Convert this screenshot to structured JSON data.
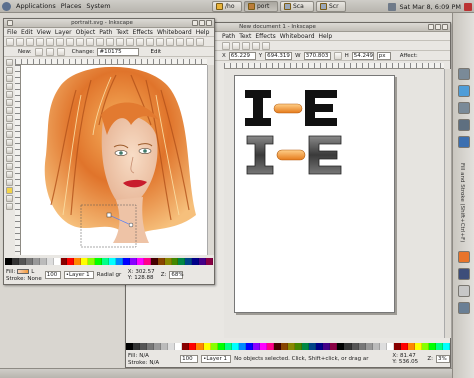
{
  "top_panel": {
    "menus": [
      "Applications",
      "Places",
      "System"
    ],
    "tasks": [
      {
        "label": "/ho"
      },
      {
        "label": "port"
      },
      {
        "label": "Sca"
      },
      {
        "label": "Scr"
      }
    ],
    "clock": "Sat Mar  8,  6:09 PM"
  },
  "left_window": {
    "title": "portrait.svg - Inkscape",
    "menus": [
      "File",
      "Edit",
      "View",
      "Layer",
      "Object",
      "Path",
      "Text",
      "Effects",
      "Whiteboard",
      "Help"
    ],
    "toolbar": {
      "new_label": "New:",
      "change_label": "Change:",
      "change_value": "#10175",
      "edit_label": "Edit"
    },
    "status": {
      "fill_label": "Fill:",
      "fill_value": "L",
      "stroke_label": "Stroke:",
      "stroke_value": "None",
      "opacity": "100",
      "layer": "•Layer 1",
      "gradient_label": "Radial gr",
      "x_label": "X:",
      "x_value": "302.57",
      "y_label": "Y:",
      "y_value": "128.88",
      "z_label": "Z:",
      "z_value": "68%"
    }
  },
  "right_window": {
    "title": "New document 1 - Inkscape",
    "menus": [
      "Path",
      "Text",
      "Effects",
      "Whiteboard",
      "Help"
    ],
    "toolbar": {
      "x_label": "X",
      "x_value": "65.229",
      "y_label": "Y",
      "y_value": "694.319",
      "w_label": "W",
      "w_value": "370.803",
      "h_label": "H",
      "h_value": "54.249",
      "unit": "px",
      "affect_label": "Affect:"
    },
    "status": {
      "fill_label": "Fill:",
      "fill_value": "N/A",
      "stroke_label": "Stroke:",
      "stroke_value": "N/A",
      "opacity": "100",
      "layer": "•Layer 1",
      "message": "No objects selected. Click, Shift+click, or drag ar",
      "x_label": "X:",
      "x_value": "81.47",
      "y_label": "Y:",
      "y_value": "536.05",
      "z_label": "Z:",
      "z_value": "3%"
    },
    "artwork": {
      "row1_letters": "I-E",
      "row2_letters": "I-E"
    }
  },
  "dock": {
    "panel_title": "Fill and Stroke (Shift+Ctrl+F)"
  },
  "colors": {
    "accent_orange": "#f39a3a",
    "panel_gray": "#c2bfb8",
    "hair_orange": "#d9732c",
    "letter_black": "#111111"
  }
}
